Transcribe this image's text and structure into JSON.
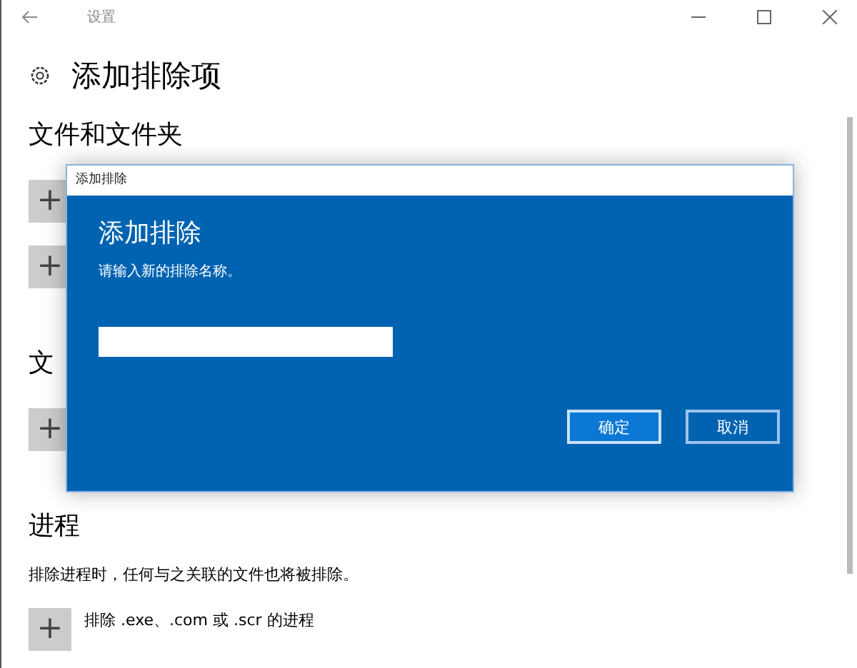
{
  "window": {
    "title": "设置"
  },
  "page_title": "添加排除项",
  "sections": [
    {
      "heading": "文件和文件夹",
      "add_buttons": [
        {
          "label": "+"
        },
        {
          "label": "+"
        }
      ]
    },
    {
      "heading": "文",
      "add_buttons": [
        {
          "label": "+"
        }
      ]
    },
    {
      "heading": "进程",
      "description": "排除进程时，任何与之关联的文件也将被排除。",
      "add_buttons": [
        {
          "label": "+",
          "text": "排除 .exe、.com 或 .scr 的进程"
        }
      ]
    }
  ],
  "dialog": {
    "title": "添加排除",
    "heading": "添加排除",
    "prompt": "请输入新的排除名称。",
    "buttons": [
      {
        "label": "确定",
        "selected": true
      },
      {
        "label": "取消",
        "selected": false
      }
    ]
  }
}
